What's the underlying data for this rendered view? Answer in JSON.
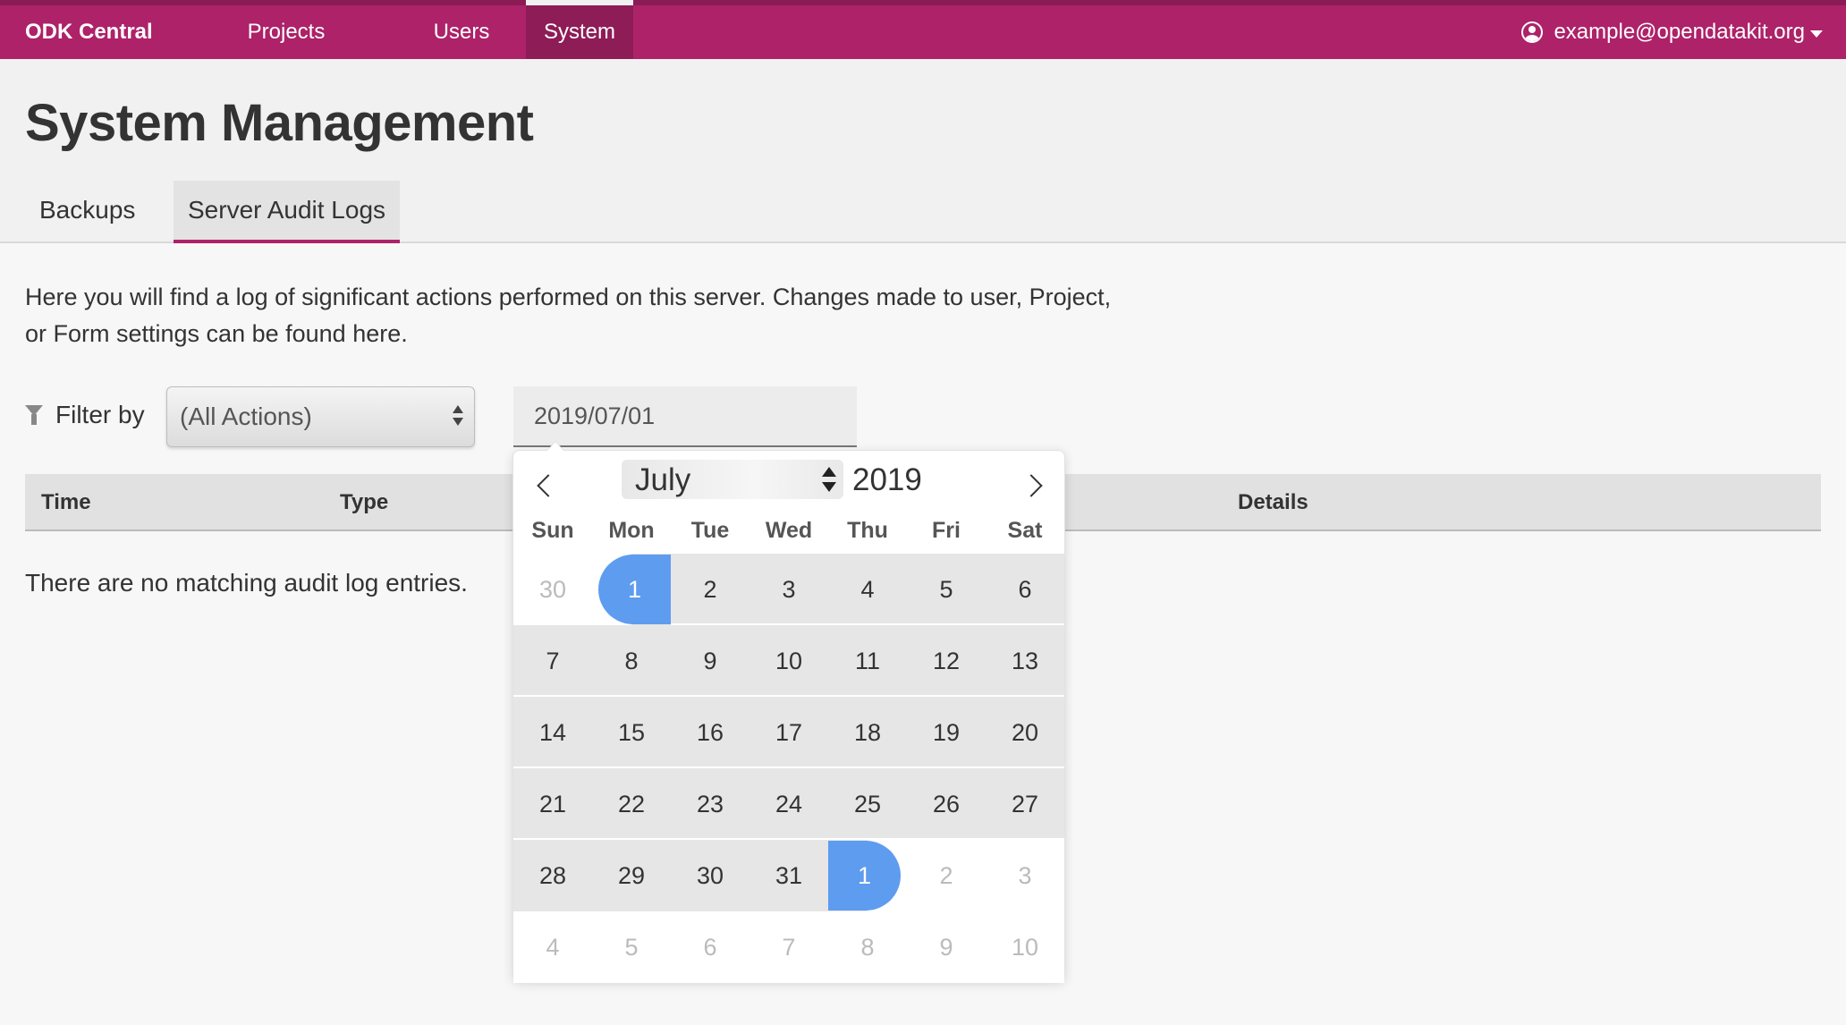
{
  "navbar": {
    "brand": "ODK Central",
    "items": [
      {
        "label": "Projects"
      },
      {
        "label": "Users"
      },
      {
        "label": "System",
        "active": true
      }
    ],
    "user_email": "example@opendatakit.org"
  },
  "header": {
    "title": "System Management",
    "tabs": [
      {
        "label": "Backups"
      },
      {
        "label": "Server Audit Logs",
        "active": true
      }
    ]
  },
  "main": {
    "description": "Here you will find a log of significant actions performed on this server. Changes made to user, Project, or Form settings can be found here.",
    "filter_label": "Filter by",
    "action_select_value": "(All Actions)",
    "date_input_value": "2019/07/01",
    "table_columns": [
      "Time",
      "Type",
      "Details"
    ],
    "empty_message": "There are no matching audit log entries."
  },
  "calendar": {
    "month": "July",
    "year": "2019",
    "weekdays": [
      "Sun",
      "Mon",
      "Tue",
      "Wed",
      "Thu",
      "Fri",
      "Sat"
    ],
    "weeks": [
      [
        "30",
        "1",
        "2",
        "3",
        "4",
        "5",
        "6"
      ],
      [
        "7",
        "8",
        "9",
        "10",
        "11",
        "12",
        "13"
      ],
      [
        "14",
        "15",
        "16",
        "17",
        "18",
        "19",
        "20"
      ],
      [
        "21",
        "22",
        "23",
        "24",
        "25",
        "26",
        "27"
      ],
      [
        "28",
        "29",
        "30",
        "31",
        "1",
        "2",
        "3"
      ],
      [
        "4",
        "5",
        "6",
        "7",
        "8",
        "9",
        "10"
      ]
    ],
    "range_start": "2019-07-01",
    "range_end": "2019-08-01"
  },
  "colors": {
    "navbar": "#ad2269",
    "accent": "#ad2269",
    "selected_day": "#5e9cf0"
  }
}
